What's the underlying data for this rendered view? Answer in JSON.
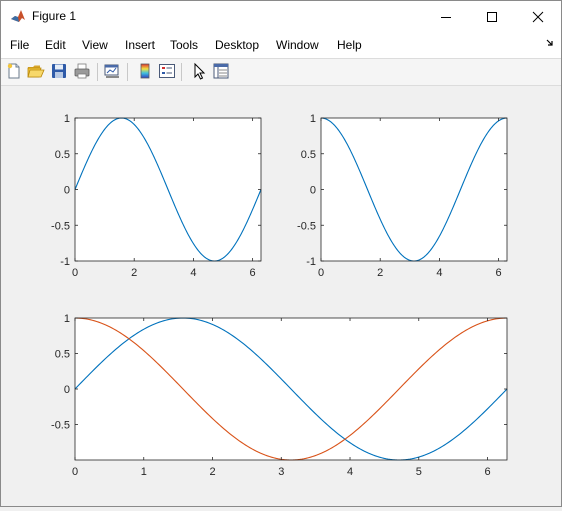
{
  "window": {
    "title": "Figure 1"
  },
  "menubar": {
    "items": [
      "File",
      "Edit",
      "View",
      "Insert",
      "Tools",
      "Desktop",
      "Window",
      "Help"
    ],
    "overflow_icon": "dock-arrow-icon"
  },
  "toolbar": {
    "buttons": [
      {
        "name": "new-figure-button",
        "icon": "new-file-icon"
      },
      {
        "name": "open-file-button",
        "icon": "folder-open-icon"
      },
      {
        "name": "save-figure-button",
        "icon": "save-disk-icon"
      },
      {
        "name": "print-figure-button",
        "icon": "printer-icon"
      },
      {
        "name": "link-plot-button",
        "icon": "link-plot-icon"
      },
      {
        "name": "insert-colorbar-button",
        "icon": "colorbar-icon"
      },
      {
        "name": "insert-legend-button",
        "icon": "legend-icon"
      },
      {
        "name": "edit-plot-button",
        "icon": "pointer-arrow-icon"
      },
      {
        "name": "property-inspector-button",
        "icon": "property-inspector-icon"
      }
    ]
  },
  "colors": {
    "sin_series": "#0072bd",
    "cos_series": "#d95319"
  },
  "chart_data": [
    {
      "type": "line",
      "position": "top-left",
      "title": "",
      "xlabel": "",
      "ylabel": "",
      "xlim": [
        0,
        6.2832
      ],
      "ylim": [
        -1,
        1
      ],
      "xticks": [
        0,
        2,
        4,
        6
      ],
      "xtick_labels": [
        "0",
        "2",
        "4",
        "6"
      ],
      "yticks": [
        -1,
        -0.5,
        0,
        0.5,
        1
      ],
      "ytick_labels": [
        "-1",
        "-0.5",
        "0",
        "0.5",
        "1"
      ],
      "grid": false,
      "series": [
        {
          "function": "sin",
          "color": "#0072bd",
          "x": [
            0,
            0.785,
            1.571,
            2.356,
            3.142,
            3.927,
            4.712,
            5.498,
            6.283
          ],
          "y": [
            0,
            0.707,
            1,
            0.707,
            0,
            -0.707,
            -1,
            -0.707,
            0
          ]
        }
      ]
    },
    {
      "type": "line",
      "position": "top-right",
      "title": "",
      "xlabel": "",
      "ylabel": "",
      "xlim": [
        0,
        6.2832
      ],
      "ylim": [
        -1,
        1
      ],
      "xticks": [
        0,
        2,
        4,
        6
      ],
      "xtick_labels": [
        "0",
        "2",
        "4",
        "6"
      ],
      "yticks": [
        -1,
        -0.5,
        0,
        0.5,
        1
      ],
      "ytick_labels": [
        "-1",
        "-0.5",
        "0",
        "0.5",
        "1"
      ],
      "grid": false,
      "series": [
        {
          "function": "cos",
          "color": "#0072bd",
          "x": [
            0,
            0.785,
            1.571,
            2.356,
            3.142,
            3.927,
            4.712,
            5.498,
            6.283
          ],
          "y": [
            1,
            0.707,
            0,
            -0.707,
            -1,
            -0.707,
            0,
            0.707,
            1
          ]
        }
      ]
    },
    {
      "type": "line",
      "position": "bottom",
      "title": "",
      "xlabel": "",
      "ylabel": "",
      "xlim": [
        0,
        6.2832
      ],
      "ylim": [
        -1,
        1
      ],
      "xticks": [
        0,
        1,
        2,
        3,
        4,
        5,
        6
      ],
      "xtick_labels": [
        "0",
        "1",
        "2",
        "3",
        "4",
        "5",
        "6"
      ],
      "yticks": [
        -0.5,
        0,
        0.5,
        1
      ],
      "ytick_labels": [
        "-0.5",
        "0",
        "0.5",
        "1"
      ],
      "grid": false,
      "series": [
        {
          "function": "sin",
          "color": "#0072bd",
          "x": [
            0,
            0.785,
            1.571,
            2.356,
            3.142,
            3.927,
            4.712,
            5.498,
            6.283
          ],
          "y": [
            0,
            0.707,
            1,
            0.707,
            0,
            -0.707,
            -1,
            -0.707,
            0
          ]
        },
        {
          "function": "cos",
          "color": "#d95319",
          "x": [
            0,
            0.785,
            1.571,
            2.356,
            3.142,
            3.927,
            4.712,
            5.498,
            6.283
          ],
          "y": [
            1,
            0.707,
            0,
            -0.707,
            -1,
            -0.707,
            0,
            0.707,
            1
          ]
        }
      ]
    }
  ]
}
